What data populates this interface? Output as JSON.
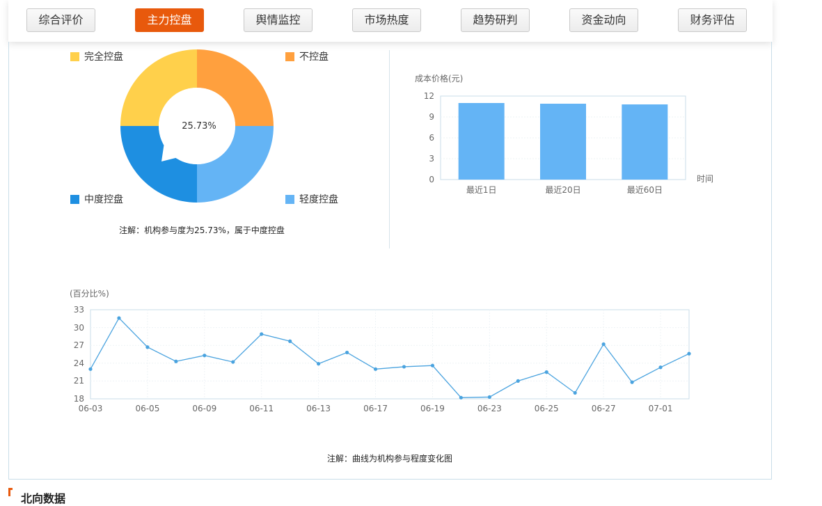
{
  "tabs": [
    {
      "label": "综合评价",
      "active": false
    },
    {
      "label": "主力控盘",
      "active": true
    },
    {
      "label": "舆情监控",
      "active": false
    },
    {
      "label": "市场热度",
      "active": false
    },
    {
      "label": "趋势研判",
      "active": false
    },
    {
      "label": "资金动向",
      "active": false
    },
    {
      "label": "财务评估",
      "active": false
    }
  ],
  "colors": {
    "accent": "#e8590c",
    "full": "#ffd04b",
    "none": "#ffa03e",
    "mid": "#1e8fe1",
    "light": "#64b4f5",
    "line": "#4aa3df"
  },
  "donut": {
    "center_label": "25.73%",
    "legend": {
      "full": "完全控盘",
      "none": "不控盘",
      "mid": "中度控盘",
      "light": "轻度控盘"
    },
    "note": "注解：机构参与度为25.73%，属于中度控盘"
  },
  "cost": {
    "ylabel": "成本价格(元)",
    "xlabel": "时间",
    "yticks": [
      "12",
      "9",
      "6",
      "3",
      "0"
    ]
  },
  "trend": {
    "ylabel": "(百分比%)",
    "yticks": [
      "33",
      "30",
      "27",
      "24",
      "21",
      "18"
    ],
    "note": "注解：曲线为机构参与程度变化图"
  },
  "section": {
    "title": "北向数据"
  },
  "chart_data": [
    {
      "type": "pie",
      "categories": [
        "完全控盘",
        "不控盘",
        "轻度控盘",
        "中度控盘"
      ],
      "values": [
        25,
        25,
        25,
        25
      ],
      "highlight": "中度控盘",
      "center_value": "25.73%"
    },
    {
      "type": "bar",
      "categories": [
        "最近1日",
        "最近20日",
        "最近60日"
      ],
      "values": [
        11.0,
        10.9,
        10.8
      ],
      "ylabel": "成本价格(元)",
      "xlabel": "时间",
      "ylim": [
        0,
        12
      ]
    },
    {
      "type": "line",
      "x": [
        "06-03",
        "06-04",
        "06-05",
        "06-06",
        "06-09",
        "06-10",
        "06-11",
        "06-12",
        "06-13",
        "06-16",
        "06-17",
        "06-18",
        "06-19",
        "06-20",
        "06-23",
        "06-24",
        "06-25",
        "06-26",
        "06-27",
        "06-30",
        "07-01",
        "07-02"
      ],
      "xtick_labels": [
        "06-03",
        "06-05",
        "06-09",
        "06-11",
        "06-13",
        "06-17",
        "06-19",
        "06-23",
        "06-25",
        "06-27",
        "07-01"
      ],
      "values": [
        23.0,
        31.6,
        26.7,
        24.3,
        25.3,
        24.2,
        28.9,
        27.7,
        23.9,
        25.8,
        23.0,
        23.4,
        23.6,
        18.2,
        18.3,
        21.0,
        22.5,
        19.0,
        27.2,
        20.8,
        23.3,
        25.6
      ],
      "ylabel": "(百分比%)",
      "ylim": [
        18,
        33
      ]
    }
  ]
}
